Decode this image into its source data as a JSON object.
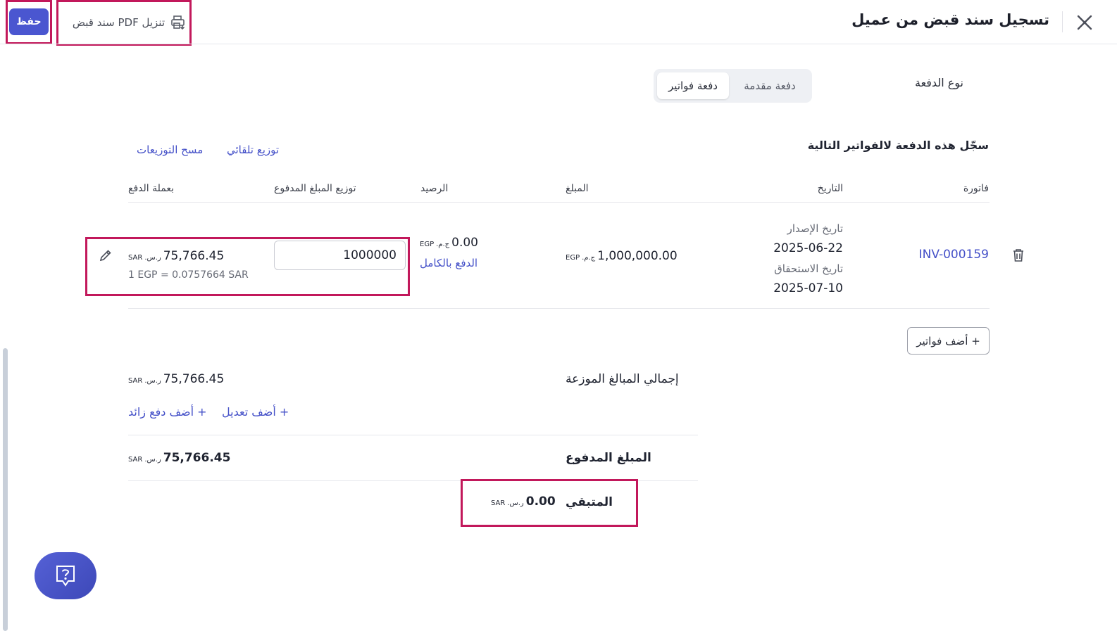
{
  "header": {
    "title": "تسجيل سند قبض من عميل",
    "download_label": "تنزيل PDF سند قبض",
    "save_label": "حفظ"
  },
  "payment_type": {
    "label": "نوع الدفعة",
    "options": [
      "دفعة مقدمة",
      "دفعة فواتير"
    ],
    "selected": "دفعة فواتير"
  },
  "invoices_section": {
    "title": "سجّل هذه الدفعة لالفواتير التالية",
    "auto_distribute": "توزيع تلقائي",
    "clear_distributions": "مسح التوزيعات",
    "columns": {
      "invoice": "فاتورة",
      "date": "التاريخ",
      "amount": "المبلغ",
      "balance": "الرصيد",
      "allocation": "توزيع المبلغ المدفوع",
      "payment_currency": "بعملة الدفع"
    },
    "rows": [
      {
        "invoice": "INV-000159",
        "issue_label": "تاريخ الإصدار",
        "issue_date": "2025-06-22",
        "due_label": "تاريخ الاستحقاق",
        "due_date": "2025-07-10",
        "amount": "1,000,000.00",
        "amount_symbol": "ج.م.",
        "amount_code": "EGP",
        "balance": "0.00",
        "balance_symbol": "ج.م.",
        "balance_code": "EGP",
        "pay_full": "الدفع بالكامل",
        "allocation_value": "1000000",
        "converted": "75,766.45",
        "converted_symbol": "ر.س.",
        "converted_code": "SAR",
        "rate": "1 EGP = 0.0757664 SAR"
      }
    ],
    "add_invoices": "+ أضف فواتير"
  },
  "summary": {
    "total_label": "إجمالي المبالغ الموزعة",
    "total_value": "75,766.45",
    "add_adjustment": "+ أضف تعديل",
    "add_overpayment": "+ أضف دفع زائد",
    "paid_label": "المبلغ المدفوع",
    "paid_value": "75,766.45",
    "remaining_label": "المتبقي",
    "remaining_value": "0.00",
    "currency_symbol": "ر.س.",
    "currency_code": "SAR"
  },
  "icons": [
    "close-icon",
    "printer-download-icon",
    "trash-icon",
    "pencil-icon",
    "help-chat-icon"
  ],
  "colors": {
    "primary": "#4a56d0",
    "link": "#4450c8",
    "highlight": "#c2185b"
  }
}
